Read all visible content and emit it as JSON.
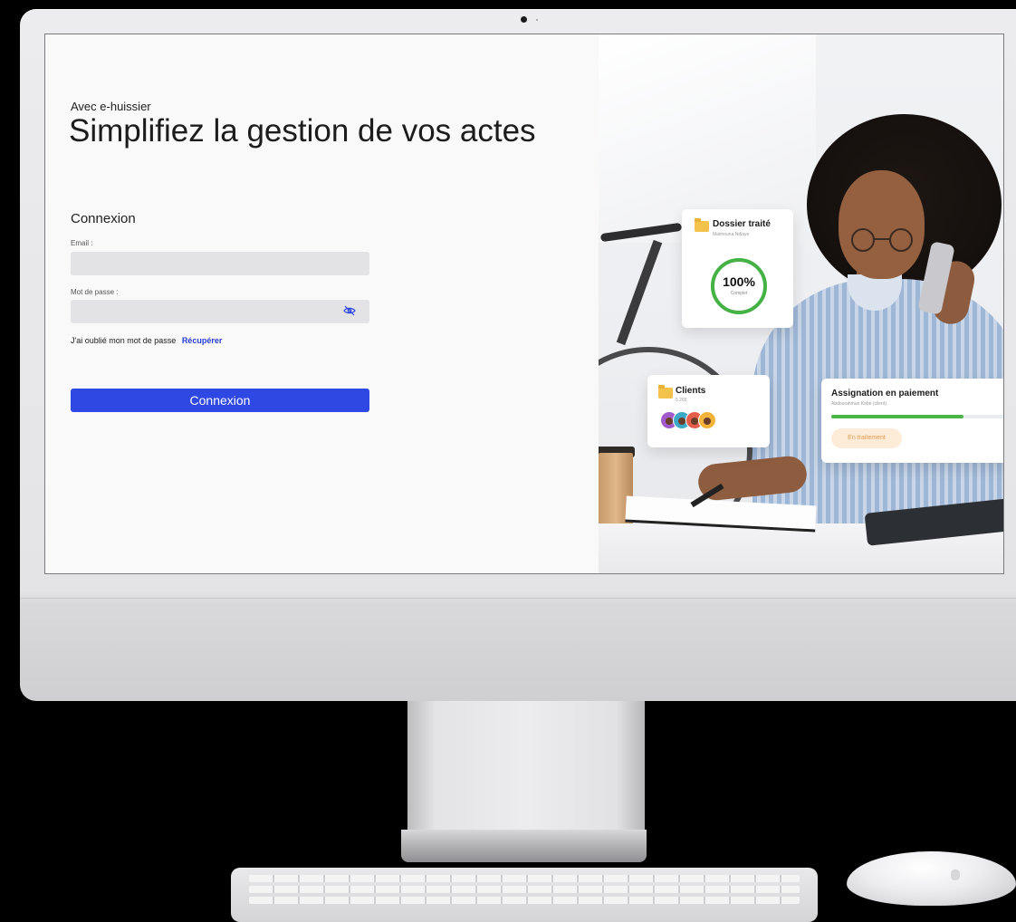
{
  "login": {
    "eyebrow": "Avec e-huissier",
    "headline": "Simplifiez la gestion de vos actes",
    "form_title": "Connexion",
    "email_label": "Email :",
    "email_value": "",
    "password_label": "Mot de passe :",
    "password_value": "",
    "password_toggle_icon": "eye-slash-icon",
    "forgot_text": "J'ai oublié mon mot de passe",
    "forgot_link": "Récupérer",
    "submit_label": "Connexion",
    "accent_color": "#2f47e3"
  },
  "cards": {
    "dossier": {
      "title": "Dossier traité",
      "subtitle": "Maimouna Ndiaye",
      "percent_text": "100%",
      "percent_label": "Complet",
      "progress": 1.0,
      "icon": "folder-icon"
    },
    "clients": {
      "title": "Clients",
      "count": "5 265",
      "icon": "folder-icon",
      "avatar_colors": [
        "#a259c9",
        "#3aa8c6",
        "#e55c4b",
        "#f2b33a"
      ]
    },
    "assignation": {
      "title": "Assignation en paiement",
      "subtitle": "Abdourahman Kébé (client)",
      "progress": 0.77,
      "status": "En traitement",
      "progress_color": "#4ab648"
    }
  }
}
